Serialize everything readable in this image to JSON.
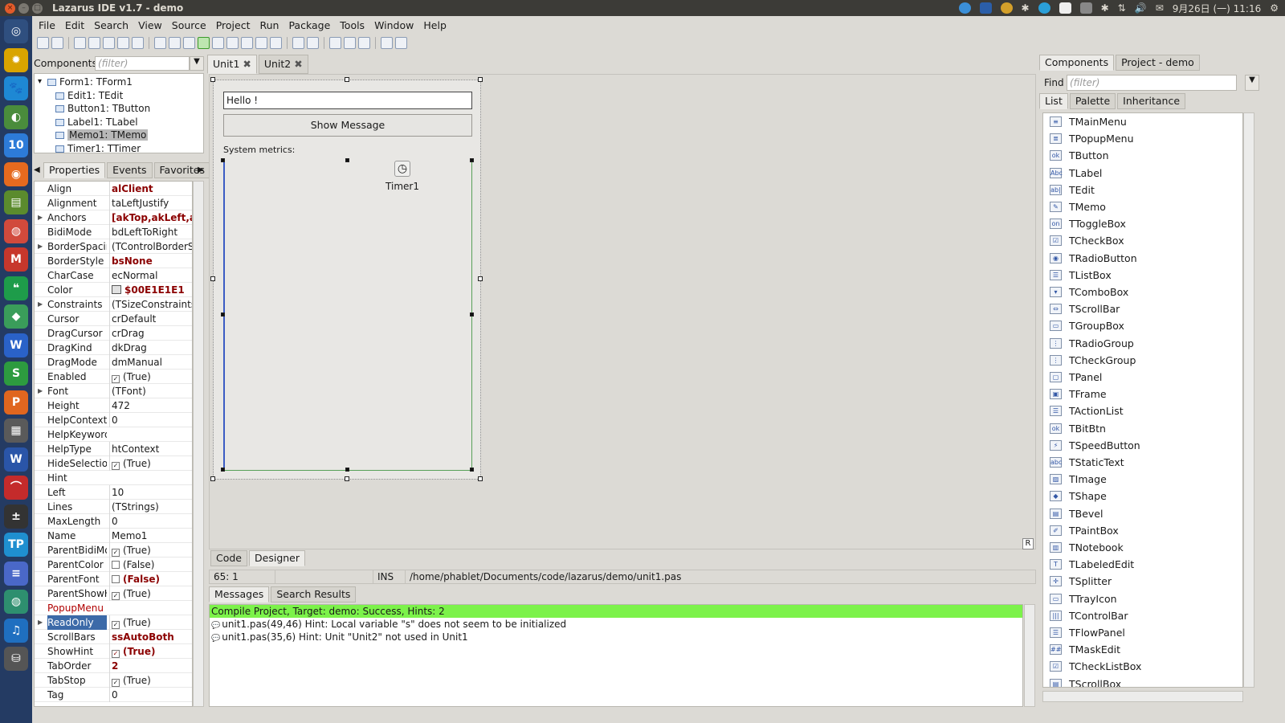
{
  "window": {
    "title": "Lazarus IDE v1.7 - demo"
  },
  "tray": {
    "datetime": "9月26日 (一) 11:16"
  },
  "launcher": {
    "items": [
      {
        "name": "ubuntu-home-icon",
        "glyph": "◎",
        "color": "#2f4f7f"
      },
      {
        "name": "sun-icon",
        "glyph": "✹",
        "color": "#d9a400"
      },
      {
        "name": "paw-icon",
        "glyph": "🐾",
        "color": "#1e88d4"
      },
      {
        "name": "chromium-icon",
        "glyph": "◐",
        "color": "#4a8c3c"
      },
      {
        "name": "calendar-icon",
        "glyph": "10",
        "color": "#2d7bd8"
      },
      {
        "name": "firefox-icon",
        "glyph": "◉",
        "color": "#e66a1f"
      },
      {
        "name": "files-icon",
        "glyph": "▤",
        "color": "#5b8b2d"
      },
      {
        "name": "chrome-icon",
        "glyph": "◍",
        "color": "#d14a3c"
      },
      {
        "name": "gmail-icon",
        "glyph": "M",
        "color": "#c7372c"
      },
      {
        "name": "hangouts-icon",
        "glyph": "❝",
        "color": "#1e9c4a"
      },
      {
        "name": "maps-icon",
        "glyph": "◆",
        "color": "#3a9d5a"
      },
      {
        "name": "writer-icon",
        "glyph": "W",
        "color": "#2a62c8"
      },
      {
        "name": "sheets-icon",
        "glyph": "S",
        "color": "#2d9b3f"
      },
      {
        "name": "presentation-icon",
        "glyph": "P",
        "color": "#e0661f"
      },
      {
        "name": "calculator-icon",
        "glyph": "▦",
        "color": "#5a5a5a"
      },
      {
        "name": "word-icon",
        "glyph": "W",
        "color": "#2a55a8"
      },
      {
        "name": "network-icon",
        "glyph": "⌒",
        "color": "#c42b2b"
      },
      {
        "name": "calc-icon",
        "glyph": "±",
        "color": "#333333"
      },
      {
        "name": "tp-icon",
        "glyph": "TP",
        "color": "#1f8fd0"
      },
      {
        "name": "notes-icon",
        "glyph": "≡",
        "color": "#4a68c8"
      },
      {
        "name": "globe-icon",
        "glyph": "◍",
        "color": "#2e8f6f"
      },
      {
        "name": "music-icon",
        "glyph": "♫",
        "color": "#1f6fc0"
      },
      {
        "name": "drive-icon",
        "glyph": "⛁",
        "color": "#555555"
      }
    ]
  },
  "menu": [
    "File",
    "Edit",
    "Search",
    "View",
    "Source",
    "Project",
    "Run",
    "Package",
    "Tools",
    "Window",
    "Help"
  ],
  "components_left": {
    "label": "Components",
    "filter_placeholder": "(filter)"
  },
  "tree": [
    {
      "text": "Form1: TForm1",
      "indent": 0
    },
    {
      "text": "Edit1: TEdit",
      "indent": 1
    },
    {
      "text": "Button1: TButton",
      "indent": 1
    },
    {
      "text": "Label1: TLabel",
      "indent": 1
    },
    {
      "text": "Memo1: TMemo",
      "indent": 1,
      "selected": true
    },
    {
      "text": "Timer1: TTimer",
      "indent": 1
    }
  ],
  "oi_tabs": [
    "Properties",
    "Events",
    "Favorites"
  ],
  "properties": [
    {
      "name": "Align",
      "value": "alClient",
      "bold": true
    },
    {
      "name": "Alignment",
      "value": "taLeftJustify"
    },
    {
      "name": "Anchors",
      "value": "[akTop,akLeft,akR",
      "bold": true,
      "expand": true
    },
    {
      "name": "BidiMode",
      "value": "bdLeftToRight"
    },
    {
      "name": "BorderSpacing",
      "value": "(TControlBorderSp",
      "expand": true
    },
    {
      "name": "BorderStyle",
      "value": "bsNone",
      "bold": true
    },
    {
      "name": "CharCase",
      "value": "ecNormal"
    },
    {
      "name": "Color",
      "value": "$00E1E1E1",
      "bold": true,
      "swatch": true
    },
    {
      "name": "Constraints",
      "value": "(TSizeConstraints)",
      "expand": true
    },
    {
      "name": "Cursor",
      "value": "crDefault"
    },
    {
      "name": "DragCursor",
      "value": "crDrag"
    },
    {
      "name": "DragKind",
      "value": "dkDrag"
    },
    {
      "name": "DragMode",
      "value": "dmManual"
    },
    {
      "name": "Enabled",
      "value": "(True)",
      "check": true
    },
    {
      "name": "Font",
      "value": "(TFont)",
      "expand": true
    },
    {
      "name": "Height",
      "value": "472"
    },
    {
      "name": "HelpContext",
      "value": "0"
    },
    {
      "name": "HelpKeyword",
      "value": ""
    },
    {
      "name": "HelpType",
      "value": "htContext"
    },
    {
      "name": "HideSelection",
      "value": "(True)",
      "check": true
    },
    {
      "name": "Hint",
      "value": ""
    },
    {
      "name": "Left",
      "value": "10"
    },
    {
      "name": "Lines",
      "value": "(TStrings)"
    },
    {
      "name": "MaxLength",
      "value": "0"
    },
    {
      "name": "Name",
      "value": "Memo1"
    },
    {
      "name": "ParentBidiMode",
      "value": "(True)",
      "check": true
    },
    {
      "name": "ParentColor",
      "value": "(False)",
      "uncheck": true
    },
    {
      "name": "ParentFont",
      "value": "(False)",
      "uncheck": true,
      "bold": true
    },
    {
      "name": "ParentShowHint",
      "value": "(True)",
      "check": true
    },
    {
      "name": "PopupMenu",
      "value": "",
      "redname": true
    },
    {
      "name": "ReadOnly",
      "value": "(True)",
      "check": true,
      "selected": true
    },
    {
      "name": "ScrollBars",
      "value": "ssAutoBoth",
      "bold": true
    },
    {
      "name": "ShowHint",
      "value": "(True)",
      "check": true,
      "bold": true
    },
    {
      "name": "TabOrder",
      "value": "2",
      "bold": true
    },
    {
      "name": "TabStop",
      "value": "(True)",
      "check": true
    },
    {
      "name": "Tag",
      "value": "0"
    }
  ],
  "editor_tabs": [
    "Unit1",
    "Unit2"
  ],
  "form": {
    "edit_text": "Hello !",
    "button_caption": "Show Message",
    "label_caption": "System metrics:",
    "timer_caption": "Timer1"
  },
  "view_tabs": [
    "Code",
    "Designer"
  ],
  "status": {
    "position": "65:  1",
    "mode": "INS",
    "file": "/home/phablet/Documents/code/lazarus/demo/unit1.pas"
  },
  "msg_tabs": [
    "Messages",
    "Search Results"
  ],
  "messages": [
    {
      "text": "Compile Project, Target: demo: Success, Hints: 2",
      "ok": true
    },
    {
      "text": "unit1.pas(49,46) Hint: Local variable \"s\" does not seem to be initialized"
    },
    {
      "text": "unit1.pas(35,6) Hint: Unit \"Unit2\" not used in Unit1"
    }
  ],
  "right_tabs": [
    "Components",
    "Project - demo"
  ],
  "find": {
    "label": "Find",
    "placeholder": "(filter)"
  },
  "list_tabs": [
    "List",
    "Palette",
    "Inheritance"
  ],
  "components": [
    {
      "name": "TMainMenu",
      "icon": "≡"
    },
    {
      "name": "TPopupMenu",
      "icon": "≣"
    },
    {
      "name": "TButton",
      "icon": "ok"
    },
    {
      "name": "TLabel",
      "icon": "Abc"
    },
    {
      "name": "TEdit",
      "icon": "ab|"
    },
    {
      "name": "TMemo",
      "icon": "✎"
    },
    {
      "name": "TToggleBox",
      "icon": "on"
    },
    {
      "name": "TCheckBox",
      "icon": "☑"
    },
    {
      "name": "TRadioButton",
      "icon": "◉"
    },
    {
      "name": "TListBox",
      "icon": "☰"
    },
    {
      "name": "TComboBox",
      "icon": "▾"
    },
    {
      "name": "TScrollBar",
      "icon": "⇔"
    },
    {
      "name": "TGroupBox",
      "icon": "▭"
    },
    {
      "name": "TRadioGroup",
      "icon": "⋮"
    },
    {
      "name": "TCheckGroup",
      "icon": "⋮"
    },
    {
      "name": "TPanel",
      "icon": "▢"
    },
    {
      "name": "TFrame",
      "icon": "▣"
    },
    {
      "name": "TActionList",
      "icon": "☰"
    },
    {
      "name": "TBitBtn",
      "icon": "ok"
    },
    {
      "name": "TSpeedButton",
      "icon": "⚡"
    },
    {
      "name": "TStaticText",
      "icon": "abc"
    },
    {
      "name": "TImage",
      "icon": "▨"
    },
    {
      "name": "TShape",
      "icon": "◆"
    },
    {
      "name": "TBevel",
      "icon": "▤"
    },
    {
      "name": "TPaintBox",
      "icon": "✐"
    },
    {
      "name": "TNotebook",
      "icon": "▥"
    },
    {
      "name": "TLabeledEdit",
      "icon": "T"
    },
    {
      "name": "TSplitter",
      "icon": "✛"
    },
    {
      "name": "TTrayIcon",
      "icon": "▭"
    },
    {
      "name": "TControlBar",
      "icon": "|||"
    },
    {
      "name": "TFlowPanel",
      "icon": "☰"
    },
    {
      "name": "TMaskEdit",
      "icon": "##"
    },
    {
      "name": "TCheckListBox",
      "icon": "☑"
    },
    {
      "name": "TScrollBox",
      "icon": "▤"
    }
  ]
}
